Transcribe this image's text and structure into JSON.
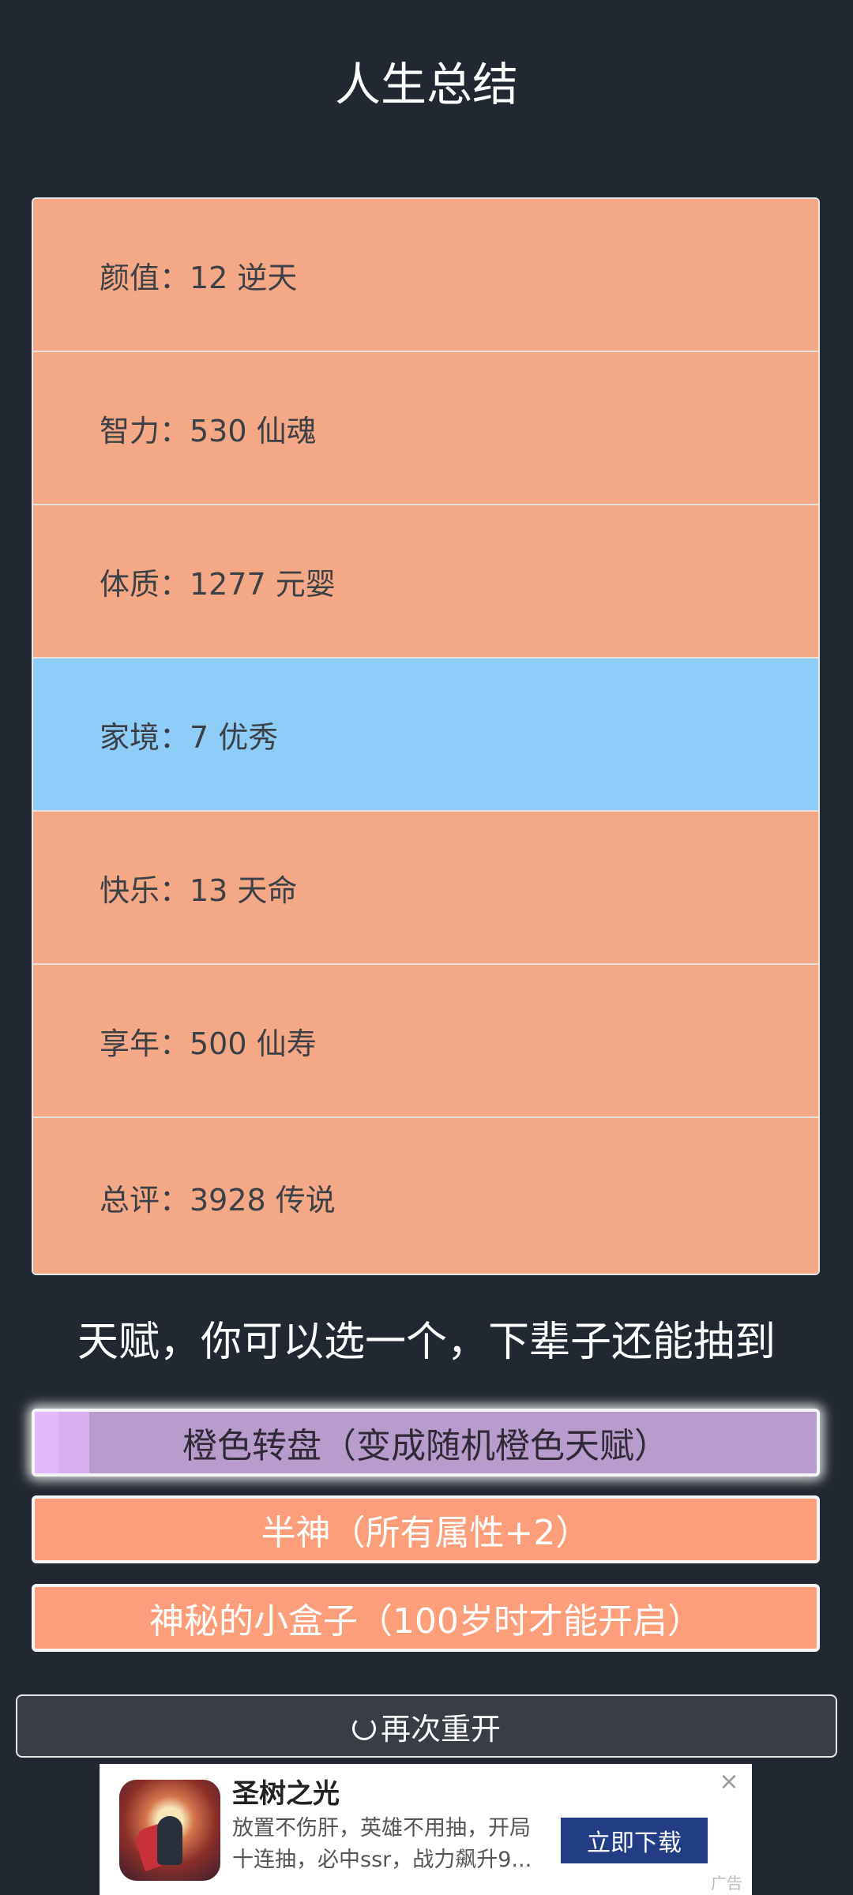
{
  "page_title": "人生总结",
  "stats": [
    {
      "label": "颜值：12 逆天",
      "color": "#f5a886"
    },
    {
      "label": "智力：530 仙魂",
      "color": "#f5a886"
    },
    {
      "label": "体质：1277 元婴",
      "color": "#f5a886"
    },
    {
      "label": "家境：7 优秀",
      "color": "#8dcdf8"
    },
    {
      "label": "快乐：13 天命",
      "color": "#f5a886"
    },
    {
      "label": "享年：500 仙寿",
      "color": "#f5a886"
    },
    {
      "label": "总评：3928 传说",
      "color": "#f5a886"
    }
  ],
  "talent_heading": "天赋，你可以选一个，下辈子还能抽到",
  "talents": [
    {
      "label": "橙色转盘（变成随机橙色天赋）",
      "color": "#b89ccc",
      "selected": true,
      "progress": 0.07
    },
    {
      "label": "半神（所有属性+2）",
      "color": "#fc9e79"
    },
    {
      "label": "神秘的小盒子（100岁时才能开启）",
      "color": "#fc9e79"
    }
  ],
  "restart_label": "再次重开",
  "ad": {
    "app_name": "圣树之光",
    "description": "放置不伤肝，英雄不用抽，开局十连抽，必中ssr，战力飙升9...",
    "cta_label": "立即下载",
    "close_icon": "close-icon",
    "ad_mark": "广告"
  }
}
